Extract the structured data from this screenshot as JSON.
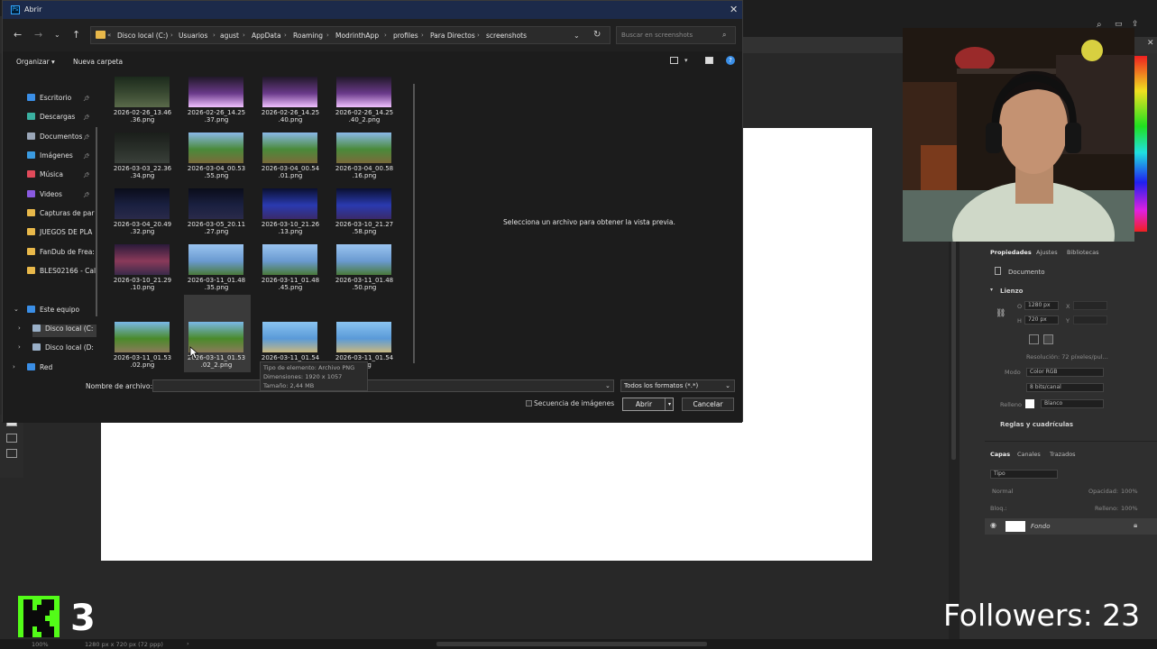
{
  "dialog": {
    "title": "Abrir",
    "app_icon": "Ps",
    "breadcrumbs": [
      "Disco local (C:)",
      "Usuarios",
      "agust",
      "AppData",
      "Roaming",
      "ModrinthApp",
      "profiles",
      "Para Directos",
      "screenshots"
    ],
    "search_placeholder": "Buscar en screenshots",
    "organize_label": "Organizar",
    "new_folder_label": "Nueva carpeta",
    "nav_items": [
      {
        "label": "Escritorio",
        "icon": "desktop-icon",
        "color": "#3a8ee6",
        "pinned": true
      },
      {
        "label": "Descargas",
        "icon": "download-icon",
        "color": "#3ab0a0",
        "pinned": true
      },
      {
        "label": "Documentos",
        "icon": "documents-icon",
        "color": "#9aa6b8",
        "pinned": true
      },
      {
        "label": "Imágenes",
        "icon": "pictures-icon",
        "color": "#3a9ae0",
        "pinned": true
      },
      {
        "label": "Música",
        "icon": "music-icon",
        "color": "#e04a5a",
        "pinned": true
      },
      {
        "label": "Videos",
        "icon": "videos-icon",
        "color": "#8a5ae0",
        "pinned": true
      },
      {
        "label": "Capturas de par",
        "icon": "folder-icon",
        "color": "#e8b84a",
        "pinned": false
      },
      {
        "label": "JUEGOS DE PLA",
        "icon": "folder-icon",
        "color": "#e8b84a",
        "pinned": false
      },
      {
        "label": "FanDub de Frea:",
        "icon": "folder-icon",
        "color": "#e8b84a",
        "pinned": false
      },
      {
        "label": "BLES02166 - Cal",
        "icon": "folder-icon",
        "color": "#e8b84a",
        "pinned": false
      }
    ],
    "tree_items": [
      {
        "label": "Este equipo",
        "icon": "computer-icon",
        "color": "#3a8ee6"
      },
      {
        "label": "Disco local (C:",
        "icon": "drive-icon",
        "color": "#9ab0c8"
      },
      {
        "label": "Disco local (D:",
        "icon": "drive-icon",
        "color": "#9ab0c8"
      },
      {
        "label": "Red",
        "icon": "network-icon",
        "color": "#3a8ee6"
      }
    ],
    "files": [
      {
        "name": "2026-02-26_13.46\n.36.png",
        "style": "cave"
      },
      {
        "name": "2026-02-26_14.25\n.37.png",
        "style": "portal"
      },
      {
        "name": "2026-02-26_14.25\n.40.png",
        "style": "portal"
      },
      {
        "name": "2026-02-26_14.25\n.40_2.png",
        "style": "portal"
      },
      {
        "name": "2026-03-03_22.36\n.34.png",
        "style": "dark"
      },
      {
        "name": "2026-03-04_00.53\n.55.png",
        "style": "grass"
      },
      {
        "name": "2026-03-04_00.54\n.01.png",
        "style": "grass"
      },
      {
        "name": "2026-03-04_00.58\n.16.png",
        "style": "grass"
      },
      {
        "name": "2026-03-04_20.49\n.32.png",
        "style": "night"
      },
      {
        "name": "2026-03-05_20.11\n.27.png",
        "style": "night"
      },
      {
        "name": "2026-03-10_21.26\n.13.png",
        "style": "water"
      },
      {
        "name": "2026-03-10_21.27\n.58.png",
        "style": "water"
      },
      {
        "name": "2026-03-10_21.29\n.10.png",
        "style": "sunset"
      },
      {
        "name": "2026-03-11_01.48\n.35.png",
        "style": "sky"
      },
      {
        "name": "2026-03-11_01.48\n.45.png",
        "style": "sky"
      },
      {
        "name": "2026-03-11_01.48\n.50.png",
        "style": "sky"
      },
      {
        "name": "2026-03-11_01.53\n.02.png",
        "style": "path"
      },
      {
        "name": "2026-03-11_01.53\n.02_2.png",
        "style": "path"
      },
      {
        "name": "2026-03-11_01.54\n.png",
        "style": "beach"
      },
      {
        "name": "2026-03-11_01.54\n.png",
        "style": "beach"
      }
    ],
    "preview_message": "Selecciona un archivo para obtener la vista previa.",
    "tooltip": {
      "type": "Tipo de elemento: Archivo PNG",
      "dimensions": "Dimensiones: 1920 x 1057",
      "size": "Tamaño: 2,44 MB"
    },
    "filename_label": "Nombre de archivo:",
    "filename_value": "",
    "file_type": "Todos los formatos (*.*)",
    "sequence_label": "Secuencia de imágenes",
    "open_label": "Abrir",
    "cancel_label": "Cancelar"
  },
  "photoshop": {
    "panel_tabs": [
      "Propiedades",
      "Ajustes",
      "Bibliotecas"
    ],
    "doc_label": "Documento",
    "canvas_section": "Lienzo",
    "width_label": "O",
    "width_value": "1280 px",
    "x_label": "X",
    "height_label": "H",
    "height_value": "720 px",
    "y_label": "Y",
    "resolution": "Resolución: 72 píxeles/pul...",
    "mode_label": "Modo",
    "mode_value": "Color RGB",
    "depth_value": "8 bits/canal",
    "fill_label": "Relleno",
    "fill_value": "Blanco",
    "rules_section": "Reglas y cuadrículas",
    "layer_tabs": [
      "Capas",
      "Canales",
      "Trazados"
    ],
    "layer_filter": "Tipo",
    "blend_mode": "Normal",
    "opacity_label": "Opacidad:",
    "opacity_value": "100%",
    "lock_label": "Bloq.:",
    "fill_label2": "Relleno:",
    "fill_value2": "100%",
    "layer_name": "Fondo",
    "zoom": "100%",
    "status_size": "1280 px x 720 px (72 ppp)"
  },
  "stream": {
    "followers": "Followers: 23",
    "badge_number": "3"
  }
}
